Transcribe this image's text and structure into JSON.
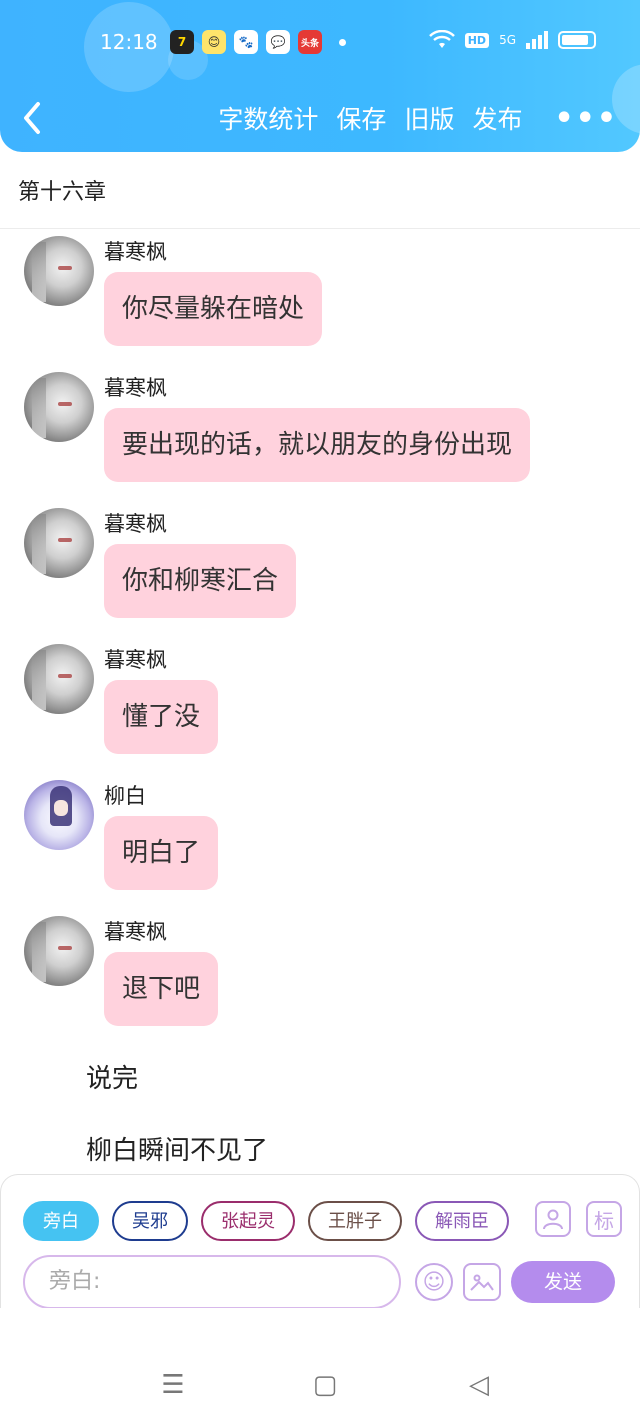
{
  "status_bar": {
    "time": "12:18",
    "app_icons": [
      "7",
      "😊",
      "🐾",
      "💬",
      "头条"
    ],
    "network": "5G",
    "hd": "HD"
  },
  "header": {
    "back_icon": "chevron-left-icon",
    "actions": [
      "字数统计",
      "保存",
      "旧版",
      "发布"
    ],
    "more": "•••"
  },
  "chapter_title": "第十六章",
  "messages": [
    {
      "sender": "暮寒枫",
      "text": "你尽量躲在暗处",
      "avatar": "gray"
    },
    {
      "sender": "暮寒枫",
      "text": "要出现的话，就以朋友的身份出现",
      "avatar": "gray"
    },
    {
      "sender": "暮寒枫",
      "text": "你和柳寒汇合",
      "avatar": "gray"
    },
    {
      "sender": "暮寒枫",
      "text": "懂了没",
      "avatar": "gray"
    },
    {
      "sender": "柳白",
      "text": "明白了",
      "avatar": "purple"
    },
    {
      "sender": "暮寒枫",
      "text": "退下吧",
      "avatar": "gray"
    }
  ],
  "narrations": [
    "说完",
    "柳白瞬间不见了"
  ],
  "composer": {
    "roles": [
      "旁白",
      "吴邪",
      "张起灵",
      "王胖子",
      "解雨臣"
    ],
    "active_role": "旁白",
    "add_role_icon": "person-icon",
    "tag_label": "标",
    "placeholder": "旁白:",
    "emoji_icon": "☺",
    "image_icon": "🖼",
    "send_label": "发送"
  },
  "navbar": {
    "menu": "☰",
    "home": "▢",
    "back": "◁"
  },
  "colors": {
    "header": "#3db8ff",
    "bubble": "#ffd2dd",
    "send": "#b48ced",
    "active_chip": "#45c3f2"
  }
}
